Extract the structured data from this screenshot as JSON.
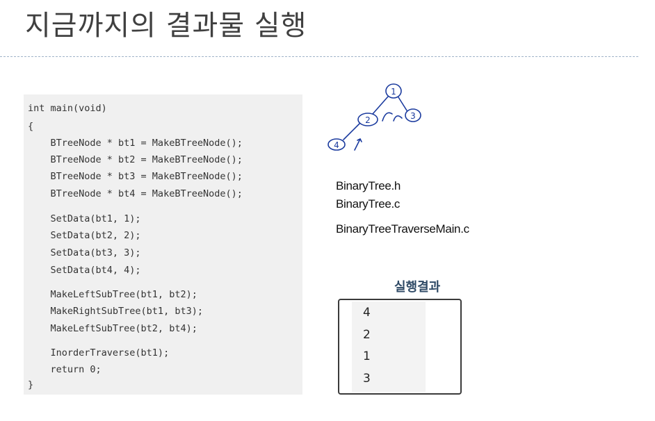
{
  "slide": {
    "title": "지금까지의 결과물 실행"
  },
  "code": {
    "lines": [
      "int main(void)",
      "{",
      "    BTreeNode * bt1 = MakeBTreeNode();",
      "    BTreeNode * bt2 = MakeBTreeNode();",
      "    BTreeNode * bt3 = MakeBTreeNode();",
      "    BTreeNode * bt4 = MakeBTreeNode();",
      "    SetData(bt1, 1);",
      "    SetData(bt2, 2);",
      "    SetData(bt3, 3);",
      "    SetData(bt4, 4);",
      "    MakeLeftSubTree(bt1, bt2);",
      "    MakeRightSubTree(bt1, bt3);",
      "    MakeLeftSubTree(bt2, bt4);",
      "    InorderTraverse(bt1);",
      "    return 0;",
      "}"
    ]
  },
  "sketch": {
    "nodes": [
      "1",
      "2",
      "3",
      "4"
    ],
    "ink_color": "#1a3a9e"
  },
  "files": [
    "BinaryTree.h",
    "BinaryTree.c",
    "BinaryTreeTraverseMain.c"
  ],
  "result": {
    "title": "실행결과",
    "lines": [
      "4",
      "2",
      "1",
      "3"
    ]
  }
}
